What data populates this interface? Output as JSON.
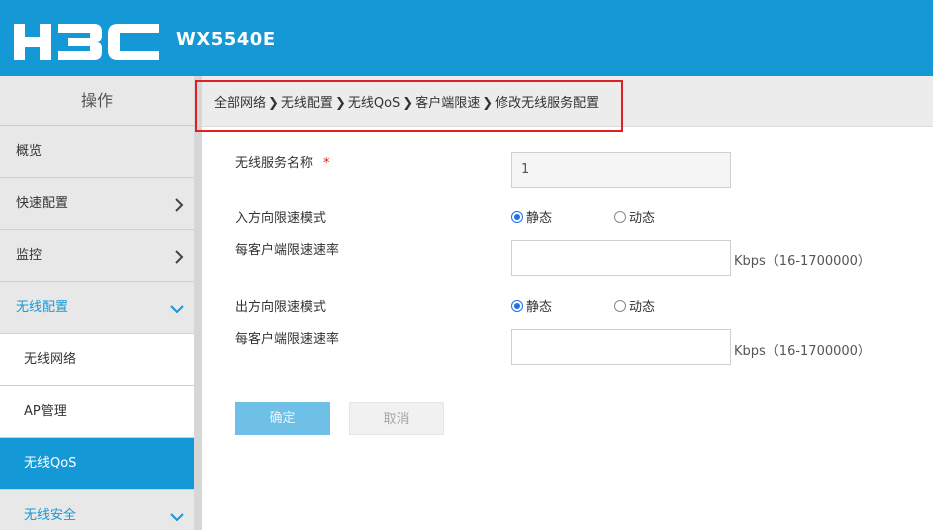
{
  "header": {
    "logo_text": "H3C",
    "product": "WX5540E"
  },
  "sidebar": {
    "title": "操作",
    "items": [
      {
        "label": "概览"
      },
      {
        "label": "快速配置",
        "icon": "chevron-right-icon"
      },
      {
        "label": "监控",
        "icon": "chevron-right-icon"
      },
      {
        "label": "无线配置",
        "icon": "chevron-down-icon"
      }
    ],
    "sub_items": [
      {
        "label": "无线网络"
      },
      {
        "label": "AP管理"
      },
      {
        "label": "无线QoS"
      }
    ],
    "next_item": {
      "label": "无线安全",
      "icon": "chevron-down-icon"
    }
  },
  "breadcrumb": {
    "items": [
      "全部网络",
      "无线配置",
      "无线QoS",
      "客户端限速",
      "修改无线服务配置"
    ],
    "separator": "❯"
  },
  "form": {
    "service_name_label": "无线服务名称",
    "required_mark": "*",
    "service_name_value": "1",
    "inbound_mode_label": "入方向限速模式",
    "inbound_rate_label": "每客户端限速速率",
    "outbound_mode_label": "出方向限速模式",
    "outbound_rate_label": "每客户端限速速率",
    "option_static": "静态",
    "option_dynamic": "动态",
    "inbound_selected": "静态",
    "outbound_selected": "静态",
    "inbound_rate_value": "",
    "outbound_rate_value": "",
    "unit_hint": "Kbps（16-1700000）"
  },
  "buttons": {
    "ok": "确定",
    "cancel": "取消"
  },
  "colors": {
    "brand": "#1499d6",
    "required": "#e02020",
    "highlight": "#e02020"
  }
}
